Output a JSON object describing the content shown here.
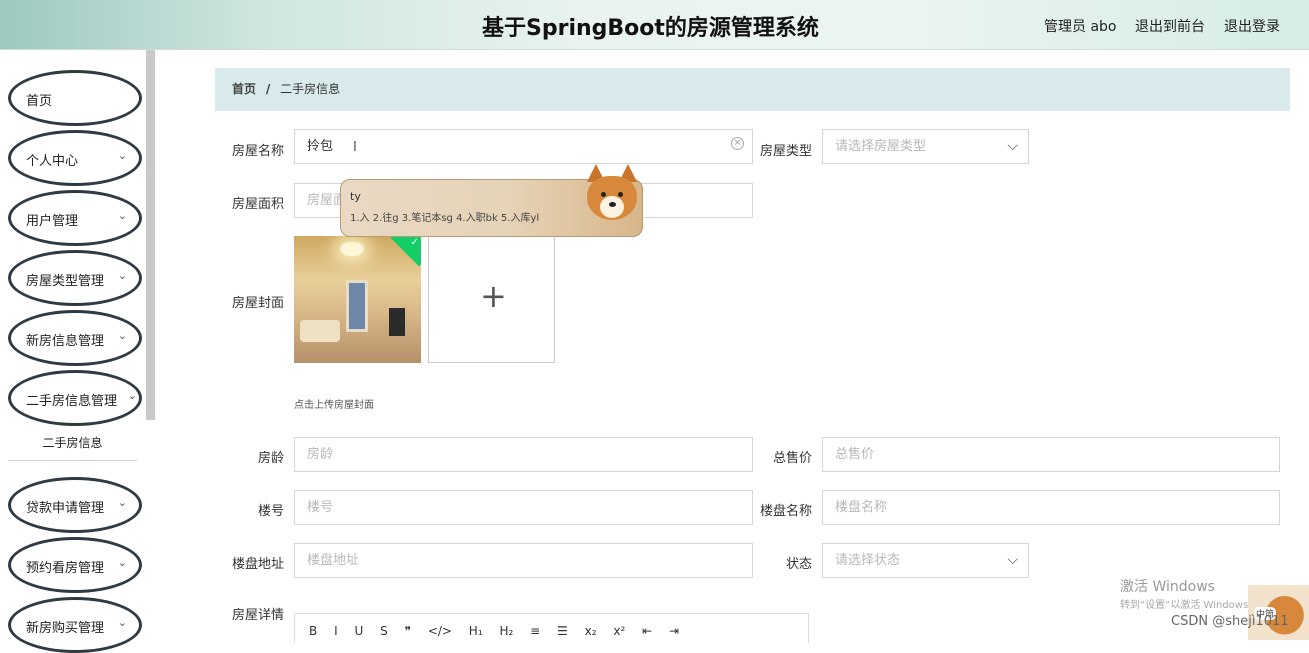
{
  "header": {
    "title": "基于SpringBoot的房源管理系统",
    "admin": "管理员 abo",
    "back_front": "退出到前台",
    "logout": "退出登录"
  },
  "sidebar": {
    "items": [
      {
        "label": "首页",
        "chevron": ""
      },
      {
        "label": "个人中心",
        "chevron": "⌄"
      },
      {
        "label": "用户管理",
        "chevron": "⌄"
      },
      {
        "label": "房屋类型管理",
        "chevron": "⌄"
      },
      {
        "label": "新房信息管理",
        "chevron": "⌄"
      },
      {
        "label": "二手房信息管理",
        "chevron": "⌄"
      },
      {
        "label": "贷款申请管理",
        "chevron": "⌄"
      },
      {
        "label": "预约看房管理",
        "chevron": "⌄"
      },
      {
        "label": "新房购买管理",
        "chevron": "⌄"
      }
    ],
    "submenu_active": "二手房信息"
  },
  "breadcrumb": {
    "home": "首页",
    "sep": "/",
    "current": "二手房信息"
  },
  "form": {
    "house_name": {
      "label": "房屋名称",
      "value": "拎包",
      "cursor": "I"
    },
    "house_type": {
      "label": "房屋类型",
      "placeholder": "请选择房屋类型"
    },
    "area": {
      "label": "房屋面积",
      "placeholder": "房屋面积"
    },
    "cover": {
      "label": "房屋封面",
      "hint": "点击上传房屋封面",
      "plus": "+"
    },
    "age": {
      "label": "房龄",
      "placeholder": "房龄"
    },
    "total_price": {
      "label": "总售价",
      "placeholder": "总售价"
    },
    "building_no": {
      "label": "楼号",
      "placeholder": "楼号"
    },
    "estate_name": {
      "label": "楼盘名称",
      "placeholder": "楼盘名称"
    },
    "estate_address": {
      "label": "楼盘地址",
      "placeholder": "楼盘地址"
    },
    "status": {
      "label": "状态",
      "placeholder": "请选择状态"
    },
    "details": {
      "label": "房屋详情"
    }
  },
  "ime": {
    "typed": "ty",
    "candidates": "1.入  2.往g  3.笔记本sg  4.入职bk  5.入库yl"
  },
  "editor_toolbar": [
    "B",
    "I",
    "U",
    "S",
    "❞",
    "</>",
    "H₁",
    "H₂",
    "≡",
    "☰",
    "x₂",
    "x²",
    "⇤",
    "⇥"
  ],
  "overlay": {
    "activate": "激活 Windows",
    "activate_sub": "转到“设置”以激活 Windows。",
    "csdn": "CSDN @shejì1011",
    "corner_tag": "中简"
  },
  "colors": {
    "breadcrumb_bg": "#d8eaec",
    "success": "#13ce66",
    "menu_border": "#2f3a44"
  }
}
